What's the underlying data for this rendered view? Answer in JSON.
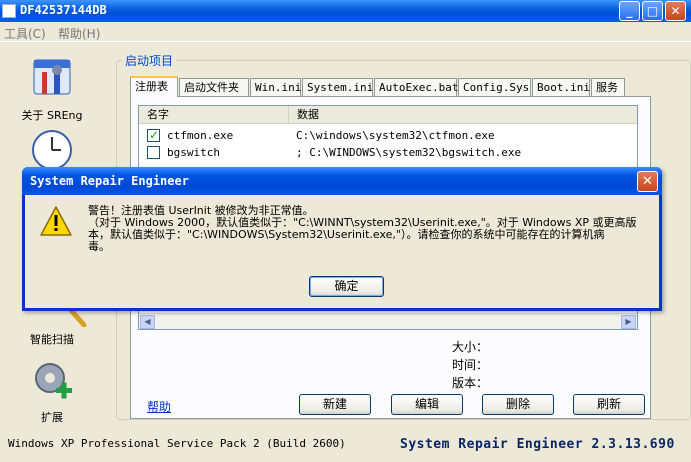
{
  "window": {
    "title": "DF42537144DB"
  },
  "menu": [
    "工具(C)",
    "帮助(H)"
  ],
  "sidebar": [
    {
      "label": "关于 SREng",
      "icon": "tools-icon"
    },
    {
      "label": "智能扫描",
      "icon": "magnifier-icon"
    },
    {
      "label": "扩展",
      "icon": "gear-plus-icon"
    }
  ],
  "group": {
    "title": "启动项目"
  },
  "tabs": [
    "注册表",
    "启动文件夹",
    "Win.ini",
    "System.ini",
    "AutoExec.bat",
    "Config.Sys",
    "Boot.ini",
    "服务"
  ],
  "list": {
    "headers": [
      "名字",
      "数据"
    ],
    "rows": [
      {
        "name": "ctfmon.exe",
        "data": "C:\\windows\\system32\\ctfmon.exe",
        "checked": true
      },
      {
        "name": "bgswitch",
        "data": "; C:\\WINDOWS\\system32\\bgswitch.exe",
        "checked": false
      }
    ]
  },
  "info_labels": [
    "大小：",
    "时间：",
    "版本："
  ],
  "help_link": "帮助",
  "buttons": [
    "新建",
    "编辑",
    "删除",
    "刷新"
  ],
  "status": {
    "left": "Windows XP Professional Service Pack 2 (Build 2600)",
    "right": "System Repair Engineer 2.3.13.690"
  },
  "dialog": {
    "title": "System Repair Engineer",
    "message": "警告！注册表值 UserInit 被修改为非正常值。\n（对于 Windows 2000，默认值类似于：\"C:\\WINNT\\system32\\Userinit.exe,\"。对于 Windows XP 或更高版\n本，默认值类似于：\"C:\\WINDOWS\\System32\\Userinit.exe,\"）。请检查你的系统中可能存在的计算机病\n毒。",
    "ok_label": "确定"
  }
}
